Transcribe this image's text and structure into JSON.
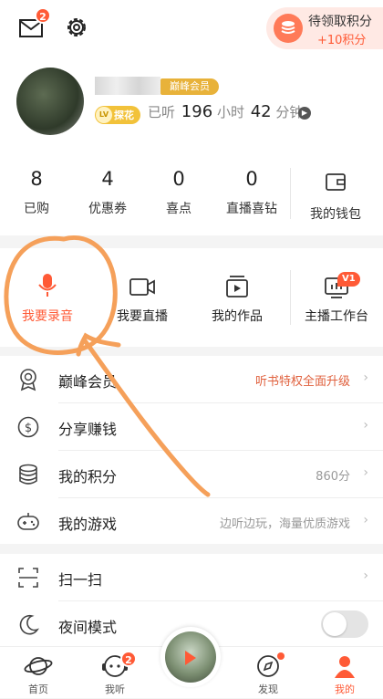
{
  "header": {
    "mail_badge": "2",
    "points_label": "待领取积分",
    "points_bonus": "+10积分"
  },
  "profile": {
    "vip_tag": "巅峰会员",
    "lv_badge": "LV",
    "level_name": "探花",
    "listened_prefix": "已听",
    "hours": "196",
    "hours_unit": "小时",
    "minutes": "42",
    "minutes_unit": "分钟"
  },
  "stats": [
    {
      "value": "8",
      "label": "已购"
    },
    {
      "value": "4",
      "label": "优惠券"
    },
    {
      "value": "0",
      "label": "喜点"
    },
    {
      "value": "0",
      "label": "直播喜钻"
    }
  ],
  "wallet_label": "我的钱包",
  "actions": [
    {
      "label": "我要录音"
    },
    {
      "label": "我要直播"
    },
    {
      "label": "我的作品"
    },
    {
      "label": "主播工作台",
      "badge": "V1"
    }
  ],
  "menu1": [
    {
      "title": "巅峰会员",
      "right": "听书特权全面升级"
    },
    {
      "title": "分享赚钱",
      "right": ""
    },
    {
      "title": "我的积分",
      "right": "860分"
    },
    {
      "title": "我的游戏",
      "right": "边听边玩，海量优质游戏"
    }
  ],
  "menu2": [
    {
      "title": "扫一扫"
    },
    {
      "title": "夜间模式"
    }
  ],
  "tabs": [
    {
      "label": "首页"
    },
    {
      "label": "我听",
      "badge": "2"
    },
    {
      "label": "发现"
    },
    {
      "label": "我的"
    }
  ],
  "colors": {
    "accent": "#ff5a36",
    "annotation": "#f5a05a",
    "vip_gold": "#e8b23a"
  }
}
